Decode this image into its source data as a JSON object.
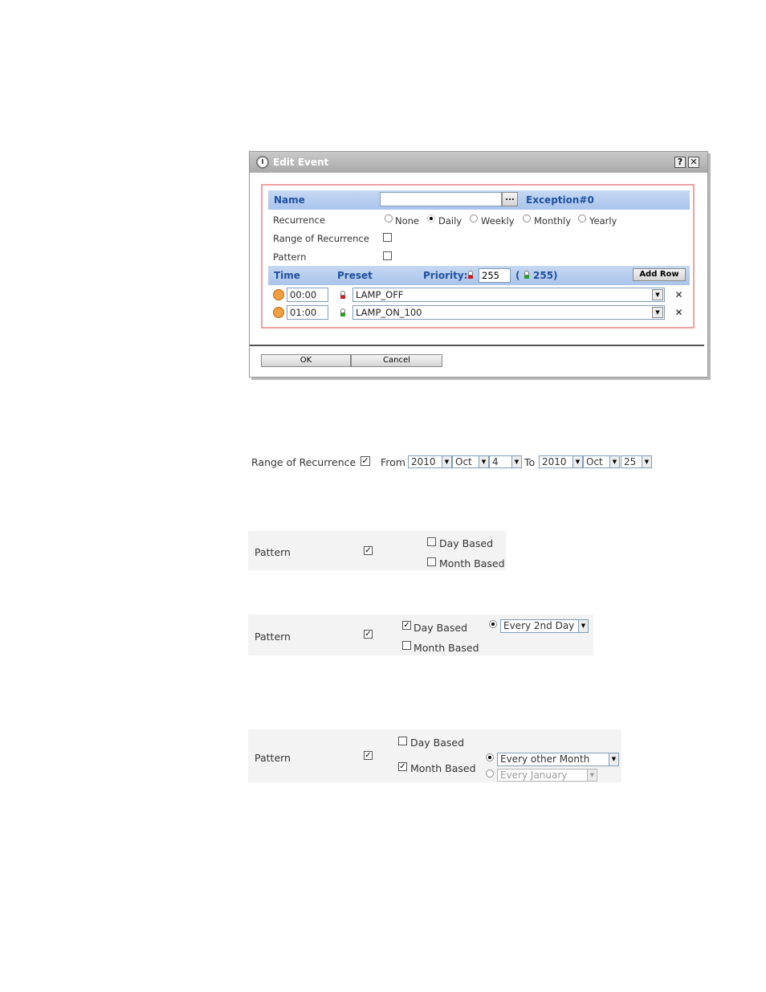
{
  "dialog": {
    "title": "Edit Event",
    "help_label": "?",
    "close_label": "✕",
    "name_label": "Name",
    "name_value": "",
    "browse_label": "...",
    "exception_label": "Exception#0",
    "recurrence_label": "Recurrence",
    "recurrence_options": [
      "None",
      "Daily",
      "Weekly",
      "Monthly",
      "Yearly"
    ],
    "recurrence_selected": "Daily",
    "range_label": "Range of Recurrence",
    "pattern_label": "Pattern",
    "time_header": "Time",
    "preset_header": "Preset",
    "priority_label": "Priority:",
    "priority_value": "255",
    "priority_on_value": "( 255)",
    "add_row_label": "Add Row",
    "rows": [
      {
        "time": "00:00",
        "preset": "LAMP_OFF",
        "lamp_color": "#cc2020"
      },
      {
        "time": "01:00",
        "preset": "LAMP_ON_100",
        "lamp_color": "#28a028"
      }
    ],
    "ok_label": "OK",
    "cancel_label": "Cancel"
  },
  "range_snippet": {
    "label": "Range of Recurrence",
    "checked": true,
    "from_label": "From",
    "from_year": "2010",
    "from_month": "Oct",
    "from_day": "4",
    "to_label": "To",
    "to_year": "2010",
    "to_month": "Oct",
    "to_day": "25"
  },
  "pattern_snippet_1": {
    "label": "Pattern",
    "checked": true,
    "day_based": "Day Based",
    "month_based": "Month Based"
  },
  "pattern_snippet_2": {
    "label": "Pattern",
    "checked": true,
    "day_based": "Day Based",
    "month_based": "Month Based",
    "day_option": "Every 2nd Day"
  },
  "pattern_snippet_3": {
    "label": "Pattern",
    "checked": true,
    "day_based": "Day Based",
    "month_based": "Month Based",
    "month_option": "Every other Month",
    "year_option": "Every January"
  },
  "colors": {
    "header_blue": "#1f4f9e",
    "highlight_border": "#f0a1a1"
  }
}
